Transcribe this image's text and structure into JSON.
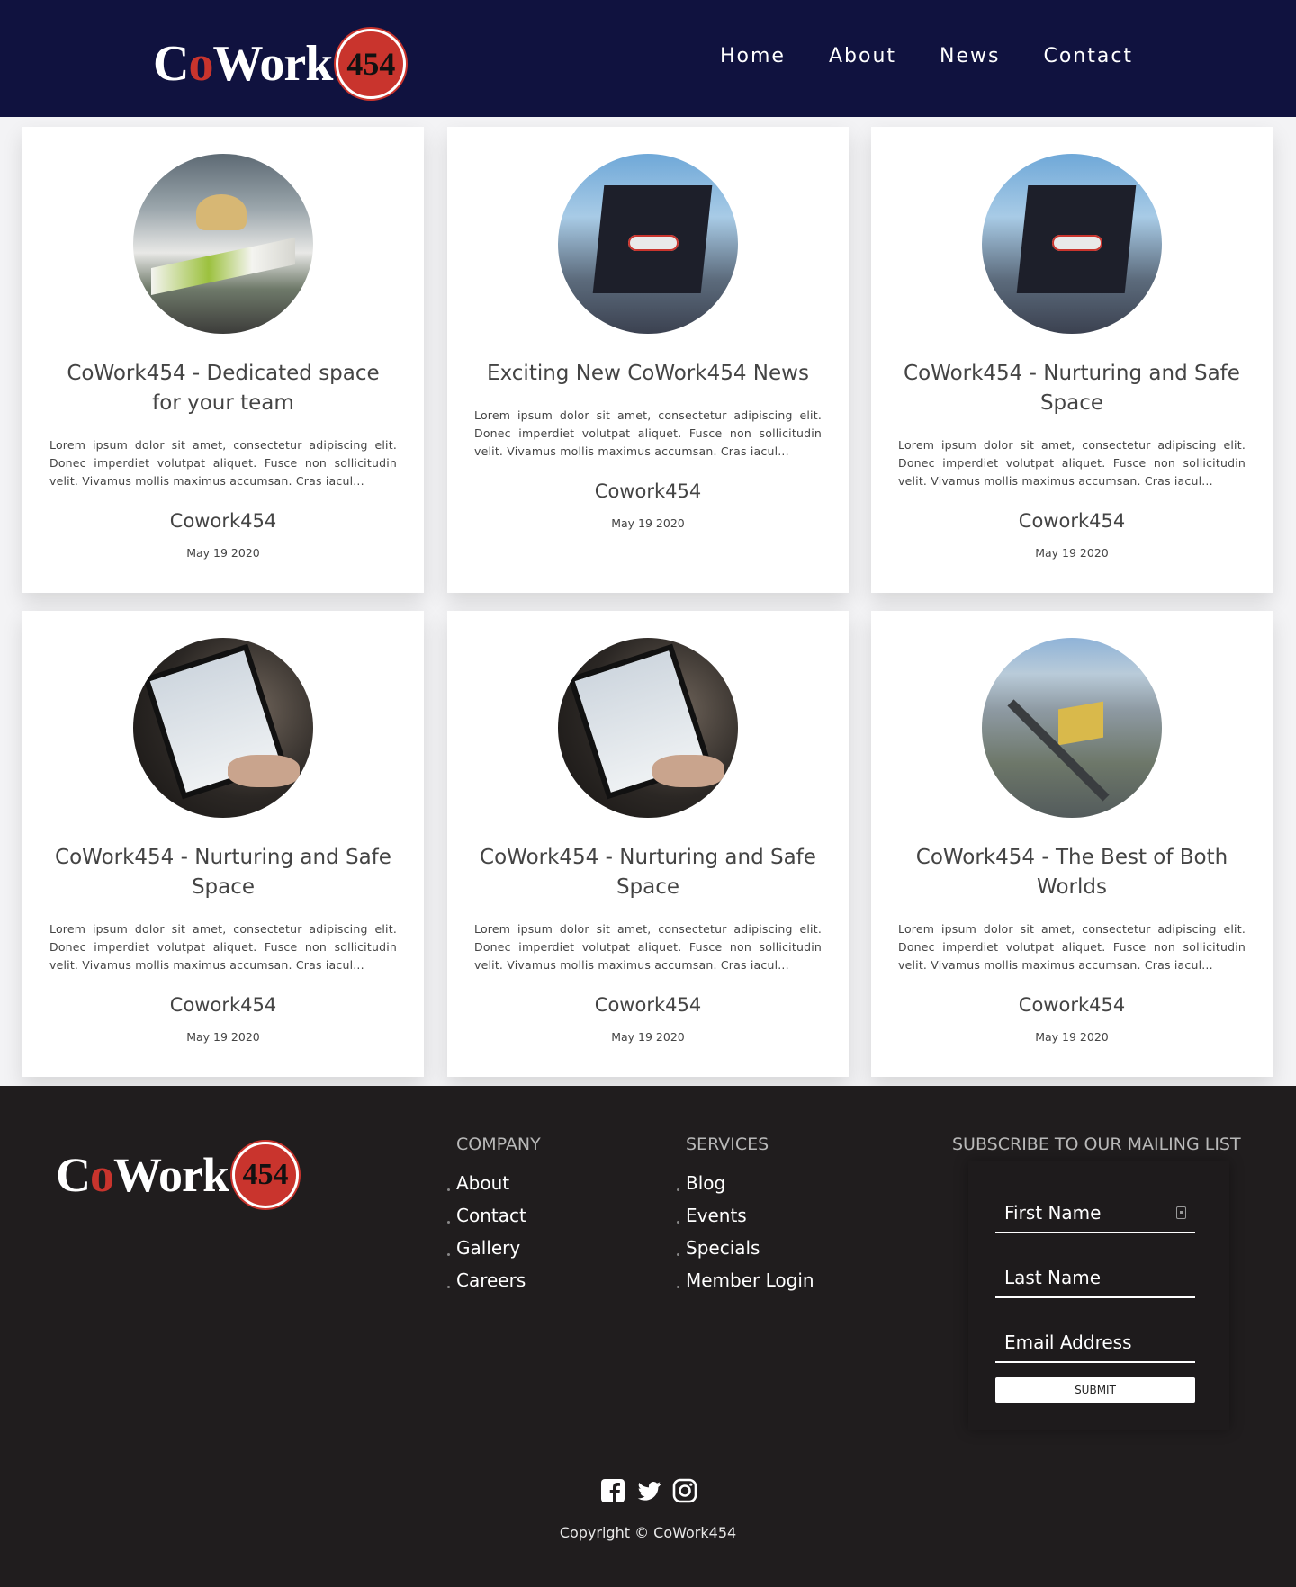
{
  "brand": {
    "word_c": "C",
    "word_o": "o",
    "word_rest": "Work",
    "number": "454",
    "accent_color": "#c9342d",
    "header_bg": "#10123f",
    "footer_bg": "#201d1e"
  },
  "nav": {
    "items": [
      {
        "label": "Home"
      },
      {
        "label": "About"
      },
      {
        "label": "News"
      },
      {
        "label": "Contact"
      }
    ]
  },
  "posts": [
    {
      "title": "CoWork454 - Dedicated space for your team",
      "excerpt": "Lorem ipsum dolor sit amet, consectetur adipiscing elit. Donec imperdiet volutpat aliquet. Fusce non sollicitudin velit. Vivamus mollis maximus accumsan. Cras iacul...",
      "author": "Cowork454",
      "date": "May 19 2020",
      "image": "interior"
    },
    {
      "title": "Exciting New CoWork454 News",
      "excerpt": "Lorem ipsum dolor sit amet, consectetur adipiscing elit. Donec imperdiet volutpat aliquet. Fusce non sollicitudin velit. Vivamus mollis maximus accumsan. Cras iacul...",
      "author": "Cowork454",
      "date": "May 19 2020",
      "image": "building"
    },
    {
      "title": "CoWork454 - Nurturing and Safe Space",
      "excerpt": "Lorem ipsum dolor sit amet, consectetur adipiscing elit. Donec imperdiet volutpat aliquet. Fusce non sollicitudin velit. Vivamus mollis maximus accumsan. Cras iacul...",
      "author": "Cowork454",
      "date": "May 19 2020",
      "image": "building"
    },
    {
      "title": "CoWork454 - Nurturing and Safe Space",
      "excerpt": "Lorem ipsum dolor sit amet, consectetur adipiscing elit. Donec imperdiet volutpat aliquet. Fusce non sollicitudin velit. Vivamus mollis maximus accumsan. Cras iacul...",
      "author": "Cowork454",
      "date": "May 19 2020",
      "image": "laptop"
    },
    {
      "title": "CoWork454 - Nurturing and Safe Space",
      "excerpt": "Lorem ipsum dolor sit amet, consectetur adipiscing elit. Donec imperdiet volutpat aliquet. Fusce non sollicitudin velit. Vivamus mollis maximus accumsan. Cras iacul...",
      "author": "Cowork454",
      "date": "May 19 2020",
      "image": "laptop"
    },
    {
      "title": "CoWork454 - The Best of Both Worlds",
      "excerpt": "Lorem ipsum dolor sit amet, consectetur adipiscing elit. Donec imperdiet volutpat aliquet. Fusce non sollicitudin velit. Vivamus mollis maximus accumsan. Cras iacul...",
      "author": "Cowork454",
      "date": "May 19 2020",
      "image": "aerial"
    }
  ],
  "footer": {
    "company": {
      "heading": "COMPANY",
      "links": [
        "About",
        "Contact",
        "Gallery",
        "Careers"
      ]
    },
    "services": {
      "heading": "SERVICES",
      "links": [
        "Blog",
        "Events",
        "Specials",
        "Member Login"
      ]
    },
    "subscribe": {
      "heading": "SUBSCRIBE TO OUR MAILING LIST",
      "first_name": "First Name",
      "last_name": "Last Name",
      "email": "Email Address",
      "submit": "SUBMIT"
    },
    "social_icons": [
      "facebook-icon",
      "twitter-icon",
      "instagram-icon"
    ],
    "copyright": "Copyright © CoWork454"
  }
}
